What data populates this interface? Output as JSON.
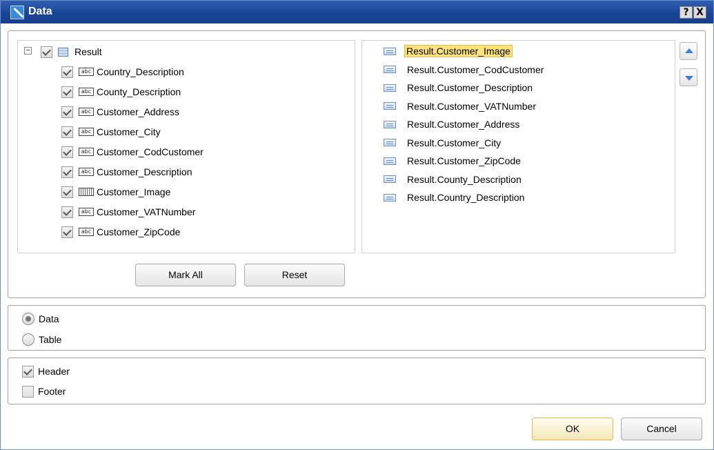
{
  "window": {
    "title": "Data",
    "help_label": "?",
    "close_label": "X"
  },
  "tree": {
    "root": {
      "label": "Result",
      "checked": true,
      "icon": "table-icon",
      "expander": "−"
    },
    "fields": [
      {
        "label": "Country_Description",
        "icon": "abc",
        "checked": true
      },
      {
        "label": "County_Description",
        "icon": "abc",
        "checked": true
      },
      {
        "label": "Customer_Address",
        "icon": "abc",
        "checked": true
      },
      {
        "label": "Customer_City",
        "icon": "abc",
        "checked": true
      },
      {
        "label": "Customer_CodCustomer",
        "icon": "abc",
        "checked": true
      },
      {
        "label": "Customer_Description",
        "icon": "abc",
        "checked": true
      },
      {
        "label": "Customer_Image",
        "icon": "image",
        "checked": true
      },
      {
        "label": "Customer_VATNumber",
        "icon": "abc",
        "checked": true
      },
      {
        "label": "Customer_ZipCode",
        "icon": "abc",
        "checked": true
      }
    ],
    "abc_glyph": "abc"
  },
  "selected_list": {
    "items": [
      "Result.Customer_Image",
      "Result.Customer_CodCustomer",
      "Result.Customer_Description",
      "Result.Customer_VATNumber",
      "Result.Customer_Address",
      "Result.Customer_City",
      "Result.Customer_ZipCode",
      "Result.County_Description",
      "Result.Country_Description"
    ],
    "selected_index": 0
  },
  "buttons": {
    "mark_all": "Mark All",
    "reset": "Reset",
    "ok": "OK",
    "cancel": "Cancel"
  },
  "mode": {
    "options": [
      "Data",
      "Table"
    ],
    "selected": "Data"
  },
  "sections": {
    "header": {
      "label": "Header",
      "checked": true
    },
    "footer": {
      "label": "Footer",
      "checked": false
    }
  },
  "colors": {
    "title_bar": "#1a4496",
    "selection_highlight": "#fde27a",
    "arrow_accent": "#3d7fd6"
  }
}
